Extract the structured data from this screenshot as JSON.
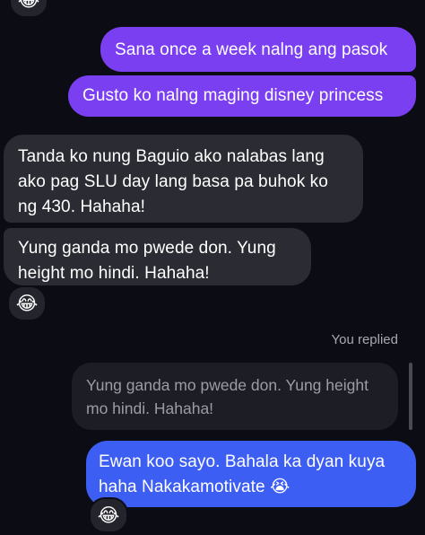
{
  "conversation": {
    "top_reaction": "😂",
    "messages": [
      {
        "id": "m1",
        "direction": "sent",
        "text": "Sana once a week nalng ang pasok"
      },
      {
        "id": "m2",
        "direction": "sent",
        "text": "Gusto ko nalng maging disney princess"
      },
      {
        "id": "m3",
        "direction": "received",
        "text": "Tanda ko nung Baguio ako nalabas lang ako pag SLU day lang basa pa buhok ko ng 430. Hahaha!"
      },
      {
        "id": "m4",
        "direction": "received",
        "text": "Yung ganda mo pwede don. Yung height mo hindi. Hahaha!",
        "reaction": "😂"
      },
      {
        "id": "m5",
        "direction": "sent",
        "text": "Ewan koo sayo. Bahala ka dyan kuya haha Nakakamotivate 😭",
        "reaction": "😂"
      }
    ],
    "reply_indicator": "You replied",
    "quoted_text": "Yung ganda mo pwede don. Yung height mo hindi. Hahaha!"
  },
  "colors": {
    "background": "#0c0d14",
    "sent_bubble": "#7b3ff2",
    "sent_bubble_latest": "#3d5ef2",
    "received_bubble": "#2b2c33",
    "quoted_bubble": "#1d1e25",
    "muted_text": "#a8a9b0"
  }
}
